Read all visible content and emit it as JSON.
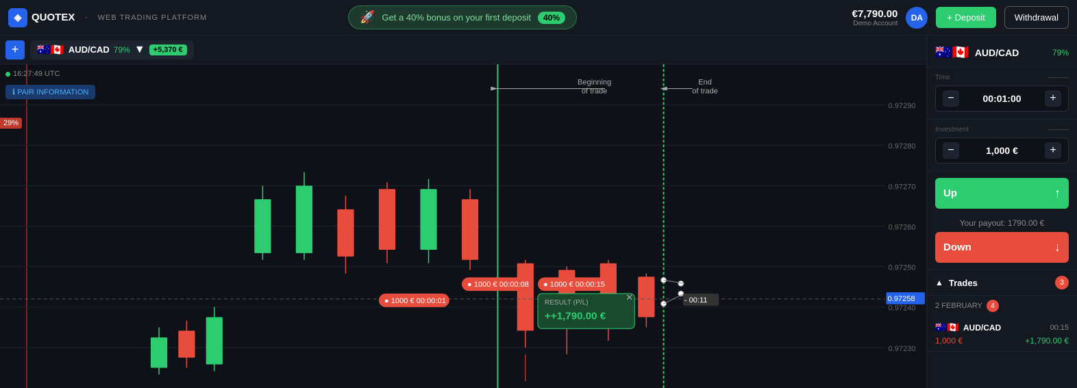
{
  "logo": {
    "icon": "◈",
    "name": "QUOTEX",
    "separator": "·",
    "sub_label": "WEB TRADING PLATFORM"
  },
  "bonus": {
    "icon": "🚀",
    "text": "Get a 40% bonus on your first deposit",
    "pct": "40%"
  },
  "balance": {
    "amount": "€7,790.00",
    "label": "Demo Account"
  },
  "avatar": {
    "initials": "DA"
  },
  "buttons": {
    "deposit": "+ Deposit",
    "withdrawal": "Withdrawal"
  },
  "toolbar": {
    "plus": "+",
    "pair_flags": "🇦🇺🇨🇦",
    "pair_name": "AUD/CAD",
    "pair_pct": "79%",
    "pair_change": "+5,370 €"
  },
  "chart": {
    "time_utc": "16:27:49 UTC",
    "pair_info_btn": "ℹ PAIR INFORMATION",
    "pct_label": "29%",
    "beginning_of_trade": "Beginning\nof trade",
    "end_of_trade": "End\nof trade",
    "price_levels": [
      "0.97290",
      "0.97280",
      "0.97270",
      "0.97260",
      "0.97250",
      "0.97240",
      "0.97230"
    ],
    "current_price": "0.97258",
    "countdown": "- 00:11",
    "trade_bets": [
      {
        "label": "1000 €",
        "time": "00:00:01"
      },
      {
        "label": "1000 €",
        "time": "00:00:08"
      },
      {
        "label": "1000 €",
        "time": "00:00:15"
      }
    ],
    "result_label": "RESULT (P/L)",
    "result_value": "++1,790.00 €"
  },
  "sidebar": {
    "pair_flags": "🇦🇺🇨🇦",
    "pair_name": "AUD/CAD",
    "pair_pct": "79%",
    "time_label": "Time",
    "time_value": "00:01:00",
    "investment_label": "Investment",
    "investment_value": "1,000 €",
    "btn_up": "Up",
    "btn_down": "Down",
    "payout_text": "Your payout: 1790.00 €",
    "trades_label": "Trades",
    "trades_count": "3",
    "trades_date": "2 FEBRUARY",
    "trades_date_count": "4",
    "trade_item": {
      "flags": "🇦🇺🇨🇦",
      "name": "AUD/CAD",
      "time": "00:15",
      "invest": "1,000 €",
      "profit": "+1,790.00 €"
    }
  }
}
